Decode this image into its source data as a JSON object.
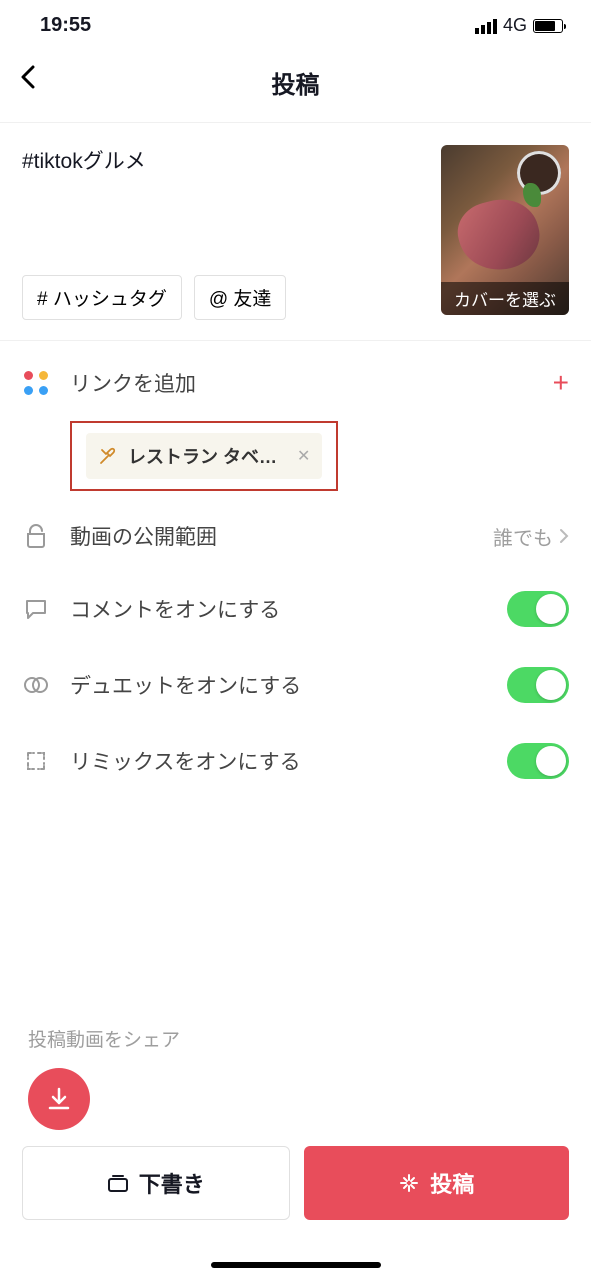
{
  "statusbar": {
    "time": "19:55",
    "network": "4G"
  },
  "header": {
    "title": "投稿"
  },
  "caption": {
    "text": "#tiktokグルメ",
    "hashtag_btn": "# ハッシュタグ",
    "mention_btn": "@ 友達",
    "cover_label": "カバーを選ぶ"
  },
  "link": {
    "label": "リンクを追加",
    "chip_label": "レストラン タベ…"
  },
  "privacy": {
    "label": "動画の公開範囲",
    "value": "誰でも"
  },
  "comments": {
    "label": "コメントをオンにする"
  },
  "duet": {
    "label": "デュエットをオンにする"
  },
  "remix": {
    "label": "リミックスをオンにする"
  },
  "share": {
    "label": "投稿動画をシェア"
  },
  "buttons": {
    "draft": "下書き",
    "post": "投稿"
  }
}
